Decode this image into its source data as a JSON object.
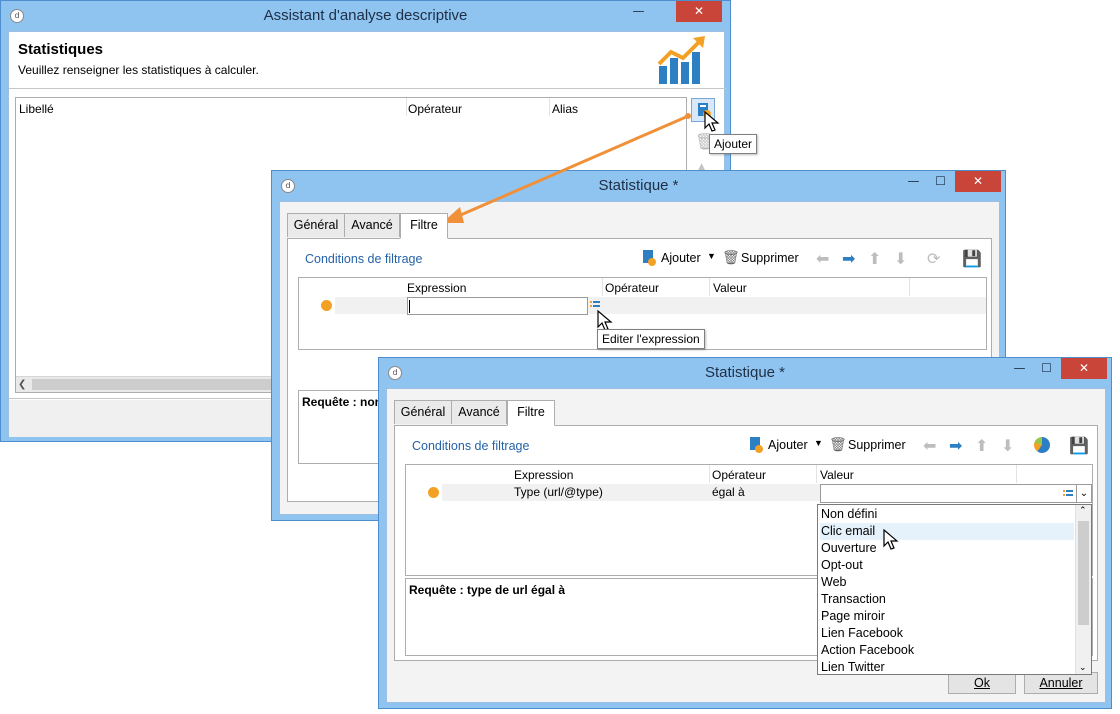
{
  "colors": {
    "frame": "#8fc4f0",
    "accent": "#f3a125",
    "link": "#2563a8",
    "close": "#c9453a"
  },
  "win1": {
    "title": "Assistant d'analyse descriptive",
    "minimize": "—",
    "close": "✕",
    "heading": "Statistiques",
    "subheading": "Veuillez renseigner les statistiques à calculer.",
    "columns": {
      "label": "Libellé",
      "operator": "Opérateur",
      "alias": "Alias"
    },
    "tooltip": "Ajouter"
  },
  "win2": {
    "title": "Statistique *",
    "minimize": "—",
    "maximize": "☐",
    "close": "✕",
    "tabs": [
      "Général",
      "Avancé",
      "Filtre"
    ],
    "filter_link": "Conditions de filtrage",
    "add_label": "Ajouter",
    "delete_label": "Supprimer",
    "columns": {
      "expression": "Expression",
      "operator": "Opérateur",
      "value": "Valeur"
    },
    "tooltip": "Editer l'expression",
    "query_label": "Requête : non"
  },
  "win3": {
    "title": "Statistique *",
    "minimize": "—",
    "maximize": "☐",
    "close": "✕",
    "tabs": [
      "Général",
      "Avancé",
      "Filtre"
    ],
    "filter_link": "Conditions de filtrage",
    "add_label": "Ajouter",
    "delete_label": "Supprimer",
    "columns": {
      "expression": "Expression",
      "operator": "Opérateur",
      "value": "Valeur"
    },
    "row": {
      "expression": "Type (url/@type)",
      "operator": "égal à",
      "value": ""
    },
    "query_label": "Requête : type de url égal à",
    "options": [
      "Non défini",
      "Clic email",
      "Ouverture",
      "Opt-out",
      "Web",
      "Transaction",
      "Page miroir",
      "Lien Facebook",
      "Action Facebook",
      "Lien Twitter"
    ],
    "ok_label": "Ok",
    "cancel_label": "Annuler"
  }
}
